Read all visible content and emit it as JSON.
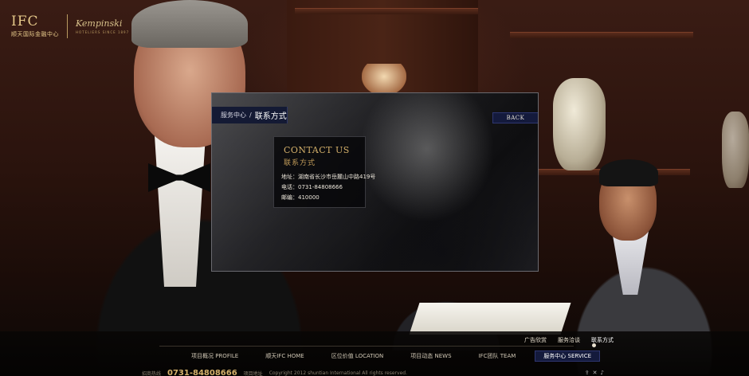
{
  "logo": {
    "ifc": "IFC",
    "cn": "顺天国际金融中心",
    "kempinski": "Kempinski",
    "kempinski_sub": "HOTELIERS SINCE 1897"
  },
  "modal": {
    "breadcrumb_parent": "服务中心",
    "breadcrumb_sep": "/",
    "breadcrumb_current": "联系方式",
    "back_label": "BACK",
    "contact_title": "CONTACT US",
    "contact_subtitle": "联系方式",
    "address": "地址：湖南省长沙市岳麓山中路419号",
    "phone": "电话：0731-84808666",
    "postcode": "邮编：410000"
  },
  "sub_nav": {
    "items": [
      "广告欣赏",
      "服务洽谈",
      "联系方式"
    ],
    "active_index": 2
  },
  "main_nav": {
    "items": [
      "项目概况 PROFILE",
      "顺天IFC HOME",
      "区位价值 LOCATION",
      "项目动态 NEWS",
      "IFC团队 TEAM",
      "服务中心 SERVICE"
    ],
    "active_index": 5
  },
  "footer": {
    "phone_label": "招商热线",
    "phone": "0731-84808666",
    "address_label": "项目地址",
    "copyright": "Copyright 2012 shuntian International All rights reserved."
  },
  "colors": {
    "accent_gold": "#d4b06a",
    "nav_active_bg": "#141a3c"
  }
}
